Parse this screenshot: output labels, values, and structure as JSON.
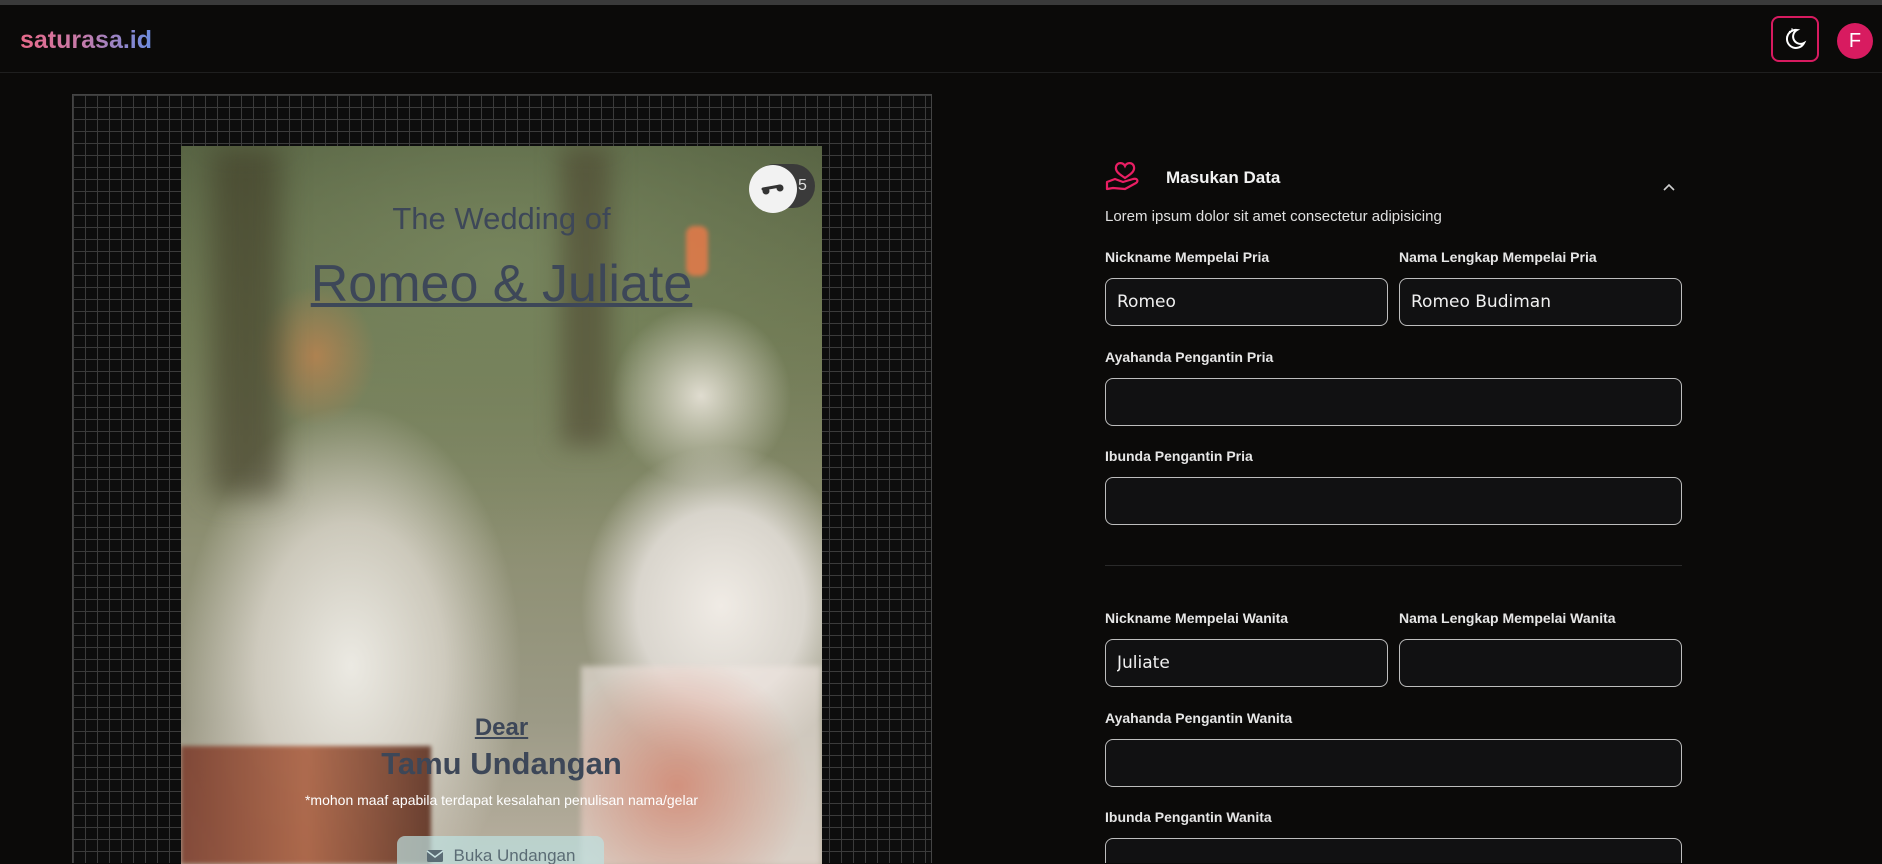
{
  "header": {
    "brand": "saturasa.id",
    "theme_icon": "moon-stars-icon",
    "avatar_initial": "F"
  },
  "preview": {
    "title_small": "The Wedding of",
    "couple_names": "Romeo & Juliate",
    "dear": "Dear",
    "guest": "Tamu Undangan",
    "note": "*mohon maaf apabila terdapat kesalahan penulisan nama/gelar",
    "open_button": "Buka Undangan",
    "music_count": "5"
  },
  "form": {
    "section_title": "Masukan Data",
    "section_desc": "Lorem ipsum dolor sit amet consectetur adipisicing",
    "groom": {
      "nickname_label": "Nickname Mempelai Pria",
      "nickname_value": "Romeo",
      "fullname_label": "Nama Lengkap Mempelai Pria",
      "fullname_value": "Romeo Budiman",
      "father_label": "Ayahanda Pengantin Pria",
      "father_value": "",
      "mother_label": "Ibunda Pengantin Pria",
      "mother_value": ""
    },
    "bride": {
      "nickname_label": "Nickname Mempelai Wanita",
      "nickname_value": "Juliate",
      "fullname_label": "Nama Lengkap Mempelai Wanita",
      "fullname_value": "",
      "father_label": "Ayahanda Pengantin Wanita",
      "father_value": "",
      "mother_label": "Ibunda Pengantin Wanita",
      "mother_value": ""
    }
  },
  "colors": {
    "accent": "#d81b60",
    "background": "#0b0a09",
    "text_dark": "#3d4758"
  }
}
